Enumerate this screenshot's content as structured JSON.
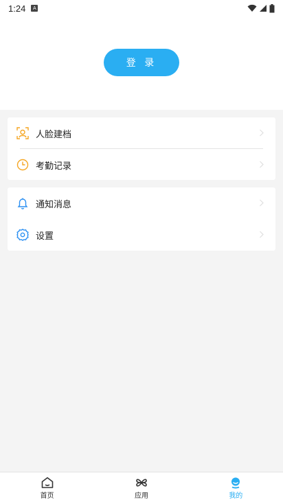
{
  "status_bar": {
    "time": "1:24",
    "notification_icon": "A"
  },
  "header": {
    "login_label": "登 录"
  },
  "menu_group_1": [
    {
      "label": "人脸建档",
      "icon": "face-profile-icon",
      "color": "#f5a623"
    },
    {
      "label": "考勤记录",
      "icon": "clock-icon",
      "color": "#f5a623"
    }
  ],
  "menu_group_2": [
    {
      "label": "通知消息",
      "icon": "bell-icon",
      "color": "#2a8ff2"
    },
    {
      "label": "设置",
      "icon": "gear-icon",
      "color": "#2a8ff2"
    }
  ],
  "bottom_nav": [
    {
      "label": "首页",
      "icon": "home-icon",
      "active": false
    },
    {
      "label": "应用",
      "icon": "apps-icon",
      "active": false
    },
    {
      "label": "我的",
      "icon": "profile-icon",
      "active": true
    }
  ],
  "colors": {
    "accent": "#2aaef2",
    "background": "#f4f4f4"
  }
}
